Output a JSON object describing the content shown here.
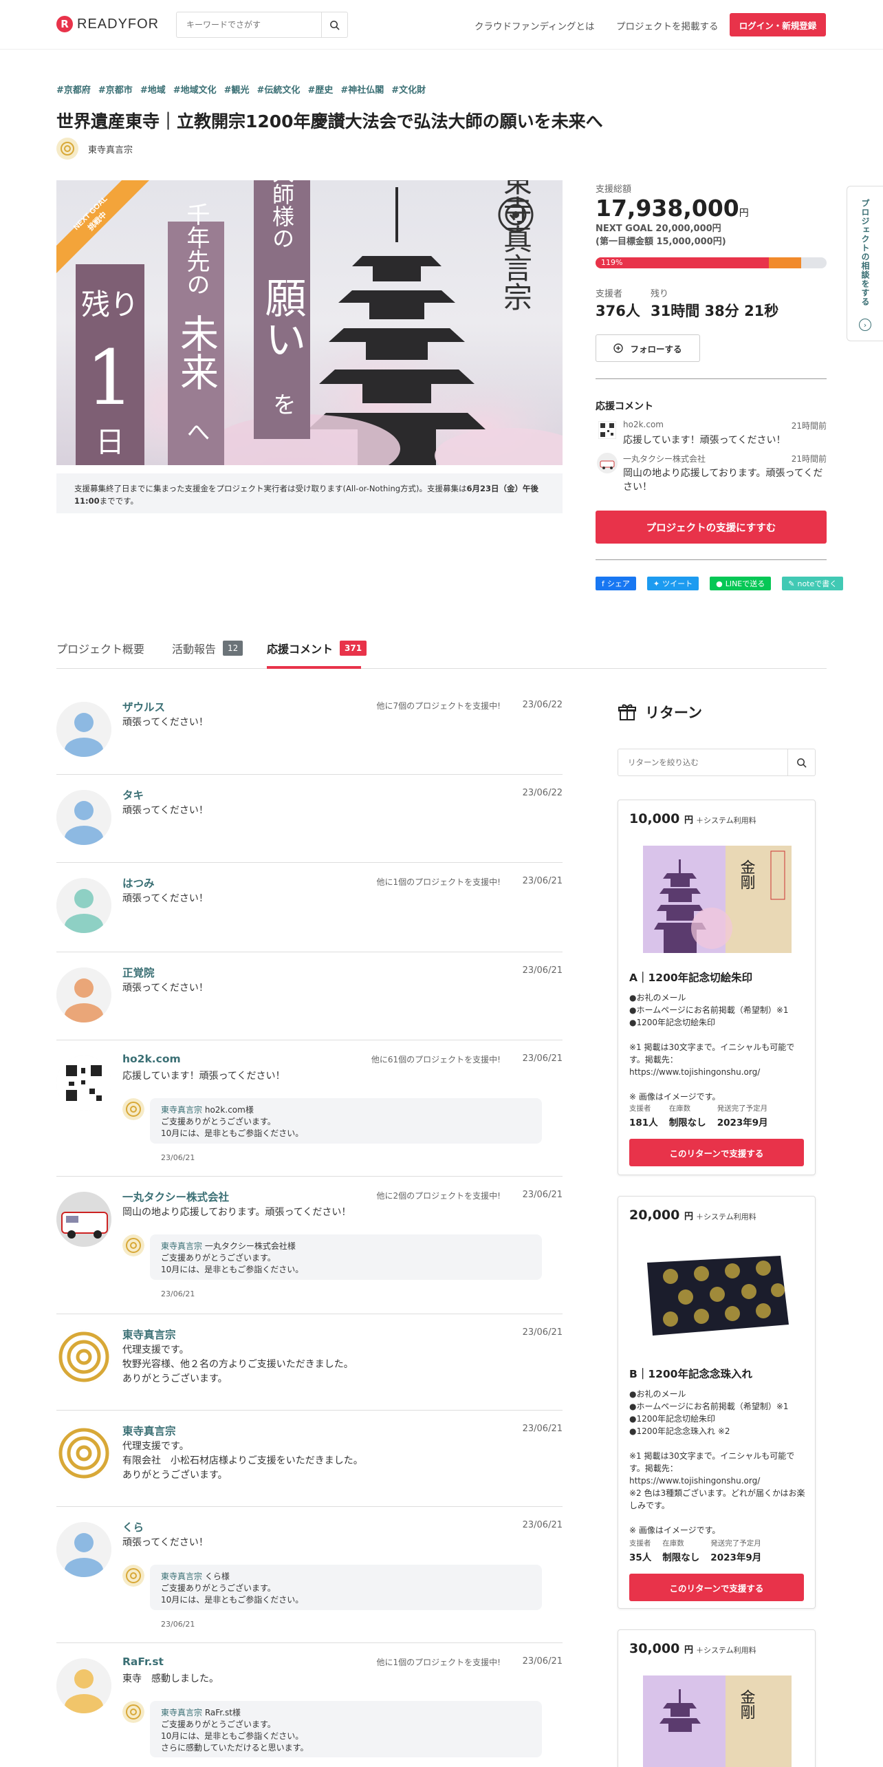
{
  "header": {
    "logo_text": "READYFOR",
    "search_placeholder": "キーワードでさがす",
    "nav": [
      "クラウドファンディングとは",
      "プロジェクトを掲載する"
    ],
    "login_label": "ログイン・新規登録"
  },
  "project": {
    "tags": [
      "#京都府",
      "#京都市",
      "#地域",
      "#地域文化",
      "#観光",
      "#伝統文化",
      "#歴史",
      "#神社仏閣",
      "#文化財"
    ],
    "title": "世界遺産東寺｜立教開宗1200年慶讃大法会で弘法大師の願いを未来へ",
    "owner": "東寺真言宗",
    "hero": {
      "ribbon_line1": "NEXT GOAL",
      "ribbon_line2": "挑戦中",
      "v1a": "残り",
      "v1b": "1",
      "v1c": "日",
      "v2a": "千年先の",
      "v2b": "未来",
      "v2c": "へ",
      "v3a": "お大師様の",
      "v3b": "願い",
      "v3c": "を",
      "brand": "東寺真言宗"
    },
    "note_prefix": "支援募集終了日までに集まった支援金をプロジェクト実行者は受け取ります(All-or-Nothing方式)。支援募集は",
    "note_bold": "6月23日（金）午後11:00",
    "note_suffix": "までです。"
  },
  "stats": {
    "total_label": "支援総額",
    "total_amount": "17,938,000",
    "total_unit": "円",
    "next_goal": "NEXT GOAL 20,000,000円",
    "first_goal": "(第一目標金額 15,000,000円)",
    "progress_label": "119%",
    "progress_primary": 0.75,
    "progress_secondary": 0.89,
    "supporters_label": "支援者",
    "supporters_value": "376人",
    "remaining_label": "残り",
    "remaining_value": "31時間 38分 21秒",
    "follow_label": "フォローする",
    "comments_title": "応援コメント",
    "support_btn": "プロジェクトの支援にすすむ"
  },
  "side_comments": [
    {
      "who": "ho2k.com",
      "when": "21時間前",
      "msg": "応援しています！頑張ってください！"
    },
    {
      "who": "一丸タクシー株式会社",
      "when": "21時間前",
      "msg": "岡山の地より応援しております。頑張ってください！"
    }
  ],
  "share": [
    {
      "label": "シェア",
      "color": "#1877f2"
    },
    {
      "label": "ツイート",
      "color": "#1d9bf0"
    },
    {
      "label": "LINEで送る",
      "color": "#06c755"
    },
    {
      "label": "noteで書く",
      "color": "#41c9b4"
    }
  ],
  "side_tab": "プロジェクトの相談をする",
  "tabs": [
    {
      "label": "プロジェクト概要",
      "badge": ""
    },
    {
      "label": "活動報告",
      "badge": "12"
    },
    {
      "label": "応援コメント",
      "badge": "371"
    }
  ],
  "comments": [
    {
      "name": "ザウルス",
      "other": "他に7個のプロジェクトを支援中!",
      "date": "23/06/22",
      "text": "頑張ってください！"
    },
    {
      "name": "タキ",
      "other": "",
      "date": "23/06/22",
      "text": "頑張ってください！"
    },
    {
      "name": "はつみ",
      "other": "他に1個のプロジェクトを支援中!",
      "date": "23/06/21",
      "text": "頑張ってください！"
    },
    {
      "name": "正覚院",
      "other": "",
      "date": "23/06/21",
      "text": "頑張ってください！"
    },
    {
      "name": "ho2k.com",
      "other": "他に61個のプロジェクトを支援中!",
      "date": "23/06/21",
      "text": "応援しています！頑張ってください！",
      "reply": {
        "from": "東寺真言宗",
        "to": "ho2k.com様",
        "l2": "ご支援ありがとうございます。",
        "l3": "10月には、是非ともご参詣ください。",
        "l4": "",
        "date": "23/06/21"
      }
    },
    {
      "name": "一丸タクシー株式会社",
      "other": "他に2個のプロジェクトを支援中!",
      "date": "23/06/21",
      "text": "岡山の地より応援しております。頑張ってください！",
      "reply": {
        "from": "東寺真言宗",
        "to": "一丸タクシー株式会社様",
        "l2": "ご支援ありがとうございます。",
        "l3": "10月には、是非ともご参詣ください。",
        "l4": "",
        "date": "23/06/21"
      }
    },
    {
      "name": "東寺真言宗",
      "other": "",
      "date": "23/06/21",
      "text": "代理支援です。",
      "text2": "牧野光容様、他２名の方よりご支援いただきました。",
      "text3": "ありがとうございます。"
    },
    {
      "name": "東寺真言宗",
      "other": "",
      "date": "23/06/21",
      "text": "代理支援です。",
      "text2": "有限会社　小松石材店様よりご支援をいただきました。",
      "text3": "ありがとうございます。"
    },
    {
      "name": "くら",
      "other": "",
      "date": "23/06/21",
      "text": "頑張ってください！",
      "reply": {
        "from": "東寺真言宗",
        "to": "くら様",
        "l2": "ご支援ありがとうございます。",
        "l3": "10月には、是非ともご参詣ください。",
        "l4": "",
        "date": "23/06/21"
      }
    },
    {
      "name": "RaFr.st",
      "other": "他に1個のプロジェクトを支援中!",
      "date": "23/06/21",
      "text": "東寺　感動しました。",
      "reply": {
        "from": "東寺真言宗",
        "to": "RaFr.st様",
        "l2": "ご支援ありがとうございます。",
        "l3": "10月には、是非ともご参詣ください。",
        "l4": "さらに感動していただけると思います。",
        "date": ""
      }
    }
  ],
  "rewards_title": "リターン",
  "rewards_search_placeholder": "リターンを絞り込む",
  "rewards": [
    {
      "price": "10,000",
      "unit": "円",
      "sys": "＋システム利用料",
      "name": "A｜1200年記念切絵朱印",
      "desc": [
        "●お礼のメール",
        "●ホームページにお名前掲載（希望制）※1",
        "●1200年記念切絵朱印",
        "",
        "※1 掲載は30文字まで。イニシャルも可能です。掲載先：https://www.tojishingonshu.org/",
        "",
        "※ 画像はイメージです。"
      ],
      "supporters_label": "支援者",
      "supporters": "181人",
      "stock_label": "在庫数",
      "stock": "制限なし",
      "ship_label": "発送完了予定月",
      "ship": "2023年9月",
      "btn": "このリターンで支援する"
    },
    {
      "price": "20,000",
      "unit": "円",
      "sys": "＋システム利用料",
      "name": "B｜1200年記念念珠入れ",
      "desc": [
        "●お礼のメール",
        "●ホームページにお名前掲載（希望制）※1",
        "●1200年記念切絵朱印",
        "●1200年記念念珠入れ ※2",
        "",
        "※1 掲載は30文字まで。イニシャルも可能です。掲載先：https://www.tojishingonshu.org/",
        "※2 色は3種類ございます。どれが届くかはお楽しみです。",
        "",
        "※ 画像はイメージです。"
      ],
      "supporters_label": "支援者",
      "supporters": "35人",
      "stock_label": "在庫数",
      "stock": "制限なし",
      "ship_label": "発送完了予定月",
      "ship": "2023年9月",
      "btn": "このリターンで支援する"
    },
    {
      "price": "30,000",
      "unit": "円",
      "sys": "＋システム利用料"
    }
  ]
}
